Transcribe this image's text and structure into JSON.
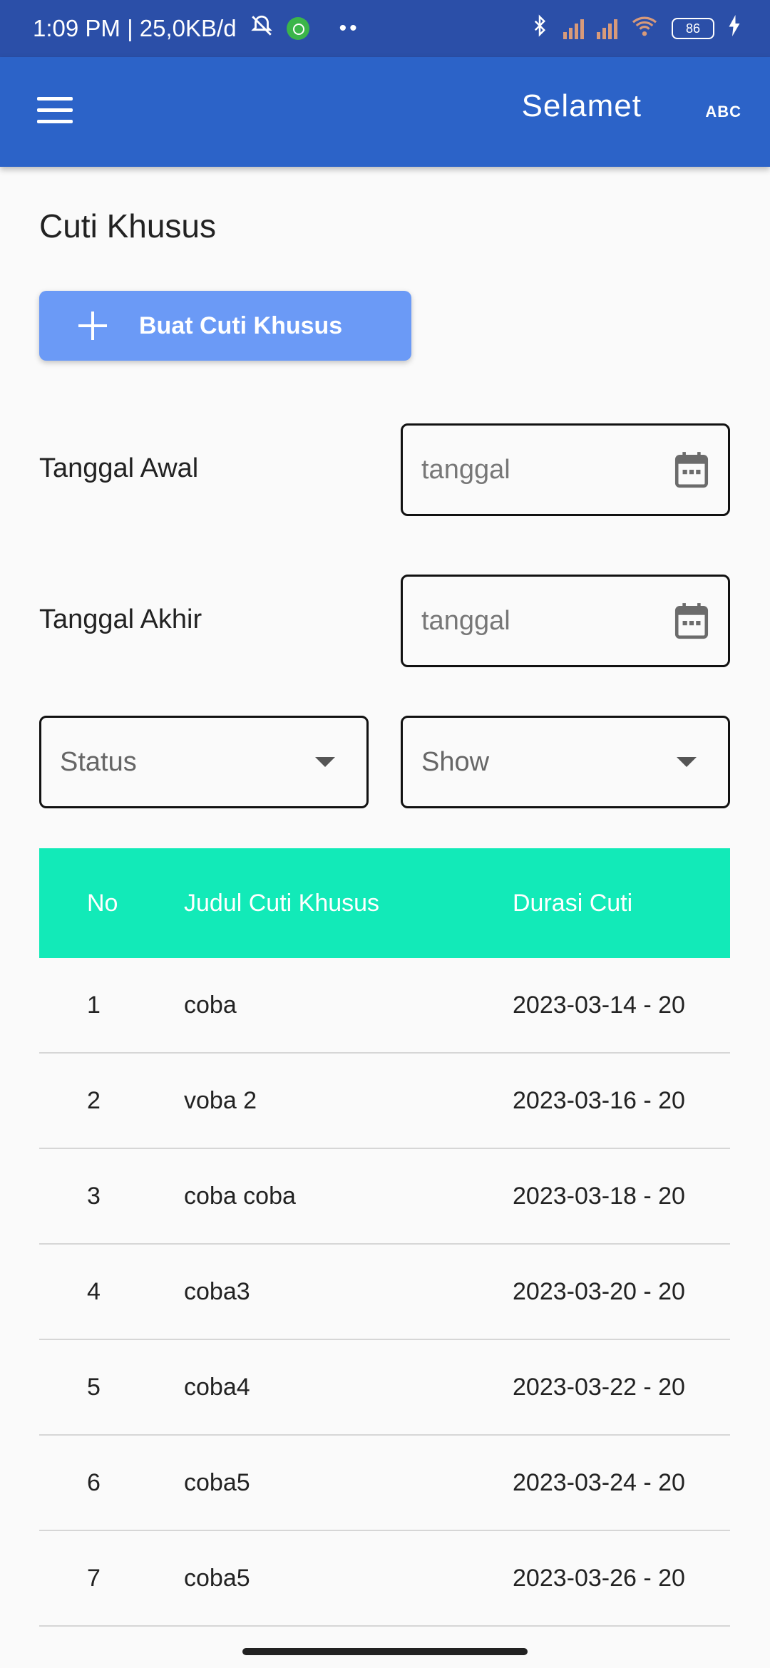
{
  "status_bar": {
    "time_speed": "1:09 PM | 25,0KB/d",
    "dots": "••",
    "battery": "86"
  },
  "app_bar": {
    "title": "Selamet",
    "right_label": "ABC"
  },
  "page": {
    "title": "Cuti Khusus",
    "create_button": "Buat Cuti Khusus"
  },
  "filters": {
    "start_label": "Tanggal Awal",
    "start_placeholder": "tanggal",
    "end_label": "Tanggal Akhir",
    "end_placeholder": "tanggal",
    "status": "Status",
    "show": "Show"
  },
  "table": {
    "headers": [
      "No",
      "Judul Cuti Khusus",
      "Durasi Cuti"
    ],
    "rows": [
      {
        "no": "1",
        "title": "coba",
        "duration": "2023-03-14 - 20"
      },
      {
        "no": "2",
        "title": "voba 2",
        "duration": "2023-03-16 - 20"
      },
      {
        "no": "3",
        "title": "coba coba",
        "duration": "2023-03-18 - 20"
      },
      {
        "no": "4",
        "title": "coba3",
        "duration": "2023-03-20 - 20"
      },
      {
        "no": "5",
        "title": "coba4",
        "duration": "2023-03-22 - 20"
      },
      {
        "no": "6",
        "title": "coba5",
        "duration": "2023-03-24 - 20"
      },
      {
        "no": "7",
        "title": "coba5",
        "duration": "2023-03-26 - 20"
      }
    ]
  },
  "colors": {
    "status_bar": "#2b4fa8",
    "app_bar": "#2c63c8",
    "button": "#6b9af6",
    "table_header": "#12eab8"
  }
}
